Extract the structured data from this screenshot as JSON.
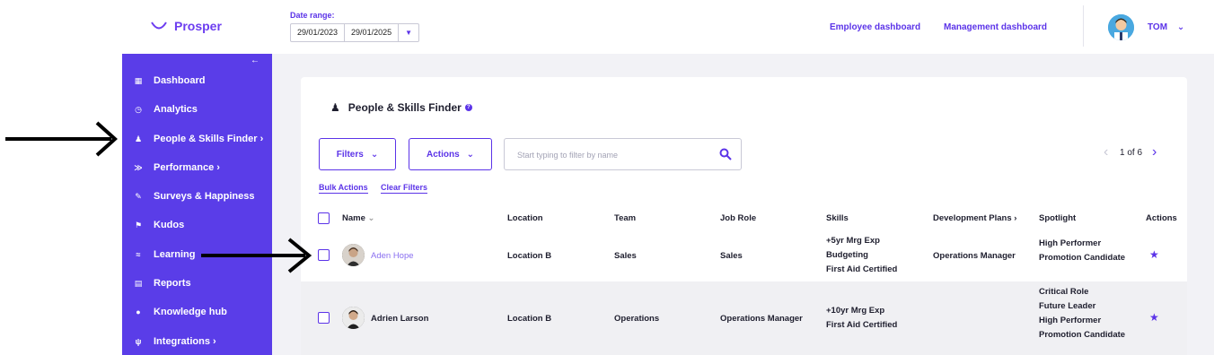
{
  "brand": {
    "name": "Prosper"
  },
  "date_range": {
    "label": "Date range:",
    "start": "29/01/2023",
    "end": "29/01/2025"
  },
  "top_nav": {
    "employee_dashboard": "Employee dashboard",
    "management_dashboard": "Management dashboard"
  },
  "user": {
    "name": "TOM"
  },
  "sidebar": {
    "items": [
      {
        "label": "Dashboard",
        "icon": "dashboard-icon"
      },
      {
        "label": "Analytics",
        "icon": "analytics-icon"
      },
      {
        "label": "People & Skills Finder ›",
        "icon": "person-icon"
      },
      {
        "label": "Performance ›",
        "icon": "performance-icon"
      },
      {
        "label": "Surveys & Happiness",
        "icon": "survey-icon"
      },
      {
        "label": "Kudos",
        "icon": "megaphone-icon"
      },
      {
        "label": "Learning",
        "icon": "learning-icon"
      },
      {
        "label": "Reports",
        "icon": "report-icon"
      },
      {
        "label": "Knowledge hub",
        "icon": "knowledge-icon"
      },
      {
        "label": "Integrations ›",
        "icon": "plug-icon"
      }
    ]
  },
  "page": {
    "title": "People & Skills Finder"
  },
  "toolbar": {
    "filters_label": "Filters",
    "actions_label": "Actions",
    "search_placeholder": "Start typing to filter by name",
    "pagination": "1 of 6",
    "bulk_actions": "Bulk Actions",
    "clear_filters": "Clear Filters"
  },
  "table": {
    "columns": {
      "name": "Name",
      "location": "Location",
      "team": "Team",
      "job_role": "Job Role",
      "skills": "Skills",
      "development_plans": "Development Plans ›",
      "spotlight": "Spotlight",
      "actions": "Actions"
    },
    "rows": [
      {
        "name": "Aden Hope",
        "location": "Location B",
        "team": "Sales",
        "job_role": "Sales",
        "skills": [
          "+5yr Mrg Exp",
          "Budgeting",
          "First Aid Certified"
        ],
        "development_plans": "Operations Manager",
        "spotlight": [
          "High Performer",
          "Promotion Candidate"
        ]
      },
      {
        "name": "Adrien Larson",
        "location": "Location B",
        "team": "Operations",
        "job_role": "Operations Manager",
        "skills": [
          "+10yr Mrg Exp",
          "First Aid Certified"
        ],
        "development_plans": "",
        "spotlight": [
          "Critical Role",
          "Future Leader",
          "High Performer",
          "Promotion Candidate"
        ]
      }
    ]
  },
  "colors": {
    "accent": "#5b33e8",
    "sidebar": "#5a3de8",
    "link": "#8a6ff0",
    "background": "#f2f2f6"
  }
}
